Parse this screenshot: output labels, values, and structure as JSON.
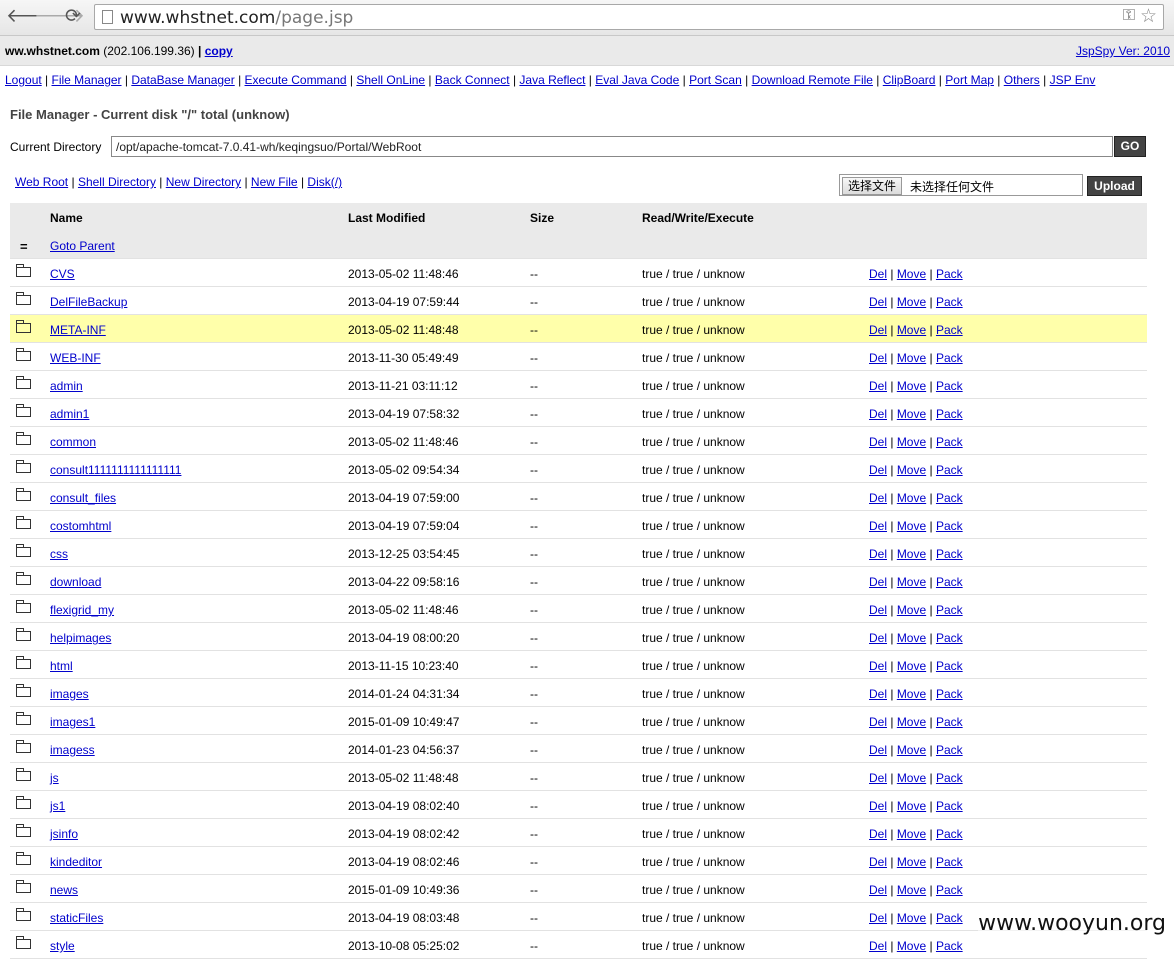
{
  "browser": {
    "url_host": "www.whstnet.com",
    "url_path": "/page.jsp",
    "back": "🡐",
    "forward": "🡒",
    "reload": "⟳"
  },
  "info": {
    "host": "ww.whstnet.com",
    "ip": "(202.106.199.36)",
    "sep": "|",
    "copy": "copy",
    "version": "JspSpy Ver: 2010"
  },
  "menu": [
    "Logout",
    "File Manager",
    "DataBase Manager",
    "Execute Command",
    "Shell OnLine",
    "Back Connect",
    "Java Reflect",
    "Eval Java Code",
    "Port Scan",
    "Download Remote File",
    "ClipBoard",
    "Port Map",
    "Others",
    "JSP Env"
  ],
  "file_manager": {
    "title": "File Manager - Current disk \"/\" total (unknow)",
    "current_dir_label": "Current Directory",
    "current_dir_value": "/opt/apache-tomcat-7.0.41-wh/keqingsuo/Portal/WebRoot",
    "go_label": "GO",
    "links": [
      "Web Root",
      "Shell Directory",
      "New Directory",
      "New File",
      "Disk(/)"
    ],
    "choose_file_label": "选择文件",
    "no_file_label": "未选择任何文件",
    "upload_label": "Upload"
  },
  "table": {
    "headers": {
      "name": "Name",
      "modified": "Last Modified",
      "size": "Size",
      "rwx": "Read/Write/Execute"
    },
    "parent_label": "Goto Parent",
    "parent_icon": "=",
    "actions": {
      "del": "Del",
      "move": "Move",
      "pack": "Pack"
    },
    "highlight_color": "#ffffaa",
    "rows": [
      {
        "name": "CVS",
        "modified": "2013-05-02 11:48:46",
        "size": "--",
        "rwx": "true / true / unknow"
      },
      {
        "name": "DelFileBackup",
        "modified": "2013-04-19 07:59:44",
        "size": "--",
        "rwx": "true / true / unknow"
      },
      {
        "name": "META-INF",
        "modified": "2013-05-02 11:48:48",
        "size": "--",
        "rwx": "true / true / unknow",
        "highlight": true
      },
      {
        "name": "WEB-INF",
        "modified": "2013-11-30 05:49:49",
        "size": "--",
        "rwx": "true / true / unknow"
      },
      {
        "name": "admin",
        "modified": "2013-11-21 03:11:12",
        "size": "--",
        "rwx": "true / true / unknow"
      },
      {
        "name": "admin1",
        "modified": "2013-04-19 07:58:32",
        "size": "--",
        "rwx": "true / true / unknow"
      },
      {
        "name": "common",
        "modified": "2013-05-02 11:48:46",
        "size": "--",
        "rwx": "true / true / unknow"
      },
      {
        "name": "consult1111111111111111",
        "modified": "2013-05-02 09:54:34",
        "size": "--",
        "rwx": "true / true / unknow"
      },
      {
        "name": "consult_files",
        "modified": "2013-04-19 07:59:00",
        "size": "--",
        "rwx": "true / true / unknow"
      },
      {
        "name": "costomhtml",
        "modified": "2013-04-19 07:59:04",
        "size": "--",
        "rwx": "true / true / unknow"
      },
      {
        "name": "css",
        "modified": "2013-12-25 03:54:45",
        "size": "--",
        "rwx": "true / true / unknow"
      },
      {
        "name": "download",
        "modified": "2013-04-22 09:58:16",
        "size": "--",
        "rwx": "true / true / unknow"
      },
      {
        "name": "flexigrid_my",
        "modified": "2013-05-02 11:48:46",
        "size": "--",
        "rwx": "true / true / unknow"
      },
      {
        "name": "helpimages",
        "modified": "2013-04-19 08:00:20",
        "size": "--",
        "rwx": "true / true / unknow"
      },
      {
        "name": "html",
        "modified": "2013-11-15 10:23:40",
        "size": "--",
        "rwx": "true / true / unknow"
      },
      {
        "name": "images",
        "modified": "2014-01-24 04:31:34",
        "size": "--",
        "rwx": "true / true / unknow"
      },
      {
        "name": "images1",
        "modified": "2015-01-09 10:49:47",
        "size": "--",
        "rwx": "true / true / unknow"
      },
      {
        "name": "imagess",
        "modified": "2014-01-23 04:56:37",
        "size": "--",
        "rwx": "true / true / unknow"
      },
      {
        "name": "js",
        "modified": "2013-05-02 11:48:48",
        "size": "--",
        "rwx": "true / true / unknow"
      },
      {
        "name": "js1",
        "modified": "2013-04-19 08:02:40",
        "size": "--",
        "rwx": "true / true / unknow"
      },
      {
        "name": "jsinfo",
        "modified": "2013-04-19 08:02:42",
        "size": "--",
        "rwx": "true / true / unknow"
      },
      {
        "name": "kindeditor",
        "modified": "2013-04-19 08:02:46",
        "size": "--",
        "rwx": "true / true / unknow"
      },
      {
        "name": "news",
        "modified": "2015-01-09 10:49:36",
        "size": "--",
        "rwx": "true / true / unknow"
      },
      {
        "name": "staticFiles",
        "modified": "2013-04-19 08:03:48",
        "size": "--",
        "rwx": "true / true / unknow"
      },
      {
        "name": "style",
        "modified": "2013-10-08 05:25:02",
        "size": "--",
        "rwx": "true / true / unknow"
      }
    ]
  },
  "watermark": "www.wooyun.org"
}
